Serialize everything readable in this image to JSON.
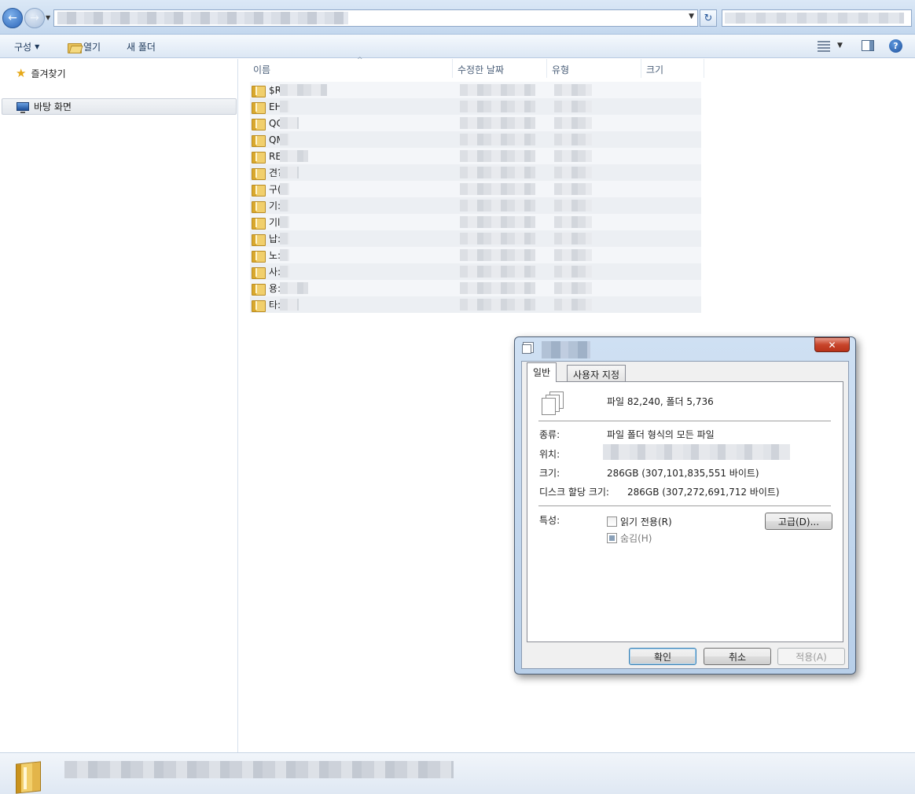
{
  "toolbar": {
    "organize_label": "구성",
    "open_label": "열기",
    "new_folder_label": "새 폴더"
  },
  "nav_pane": {
    "favorites_label": "즐겨찾기",
    "desktop_label": "바탕 화면"
  },
  "file_list": {
    "columns": {
      "name": "이름",
      "date_modified": "수정한 날짜",
      "type": "유형",
      "size": "크기"
    },
    "rows": [
      {
        "name": "$R"
      },
      {
        "name": "EH"
      },
      {
        "name": "QC"
      },
      {
        "name": "QM"
      },
      {
        "name": "REI"
      },
      {
        "name": "견?"
      },
      {
        "name": "구("
      },
      {
        "name": "기:"
      },
      {
        "name": "기l"
      },
      {
        "name": "납:"
      },
      {
        "name": "노:"
      },
      {
        "name": "사:"
      },
      {
        "name": "용:"
      },
      {
        "name": "타:"
      }
    ]
  },
  "dialog": {
    "close_glyph": "✕",
    "tabs": {
      "general": "일반",
      "custom": "사용자 지정"
    },
    "summary": "파일 82,240, 폴더 5,736",
    "type_label": "종류:",
    "type_value": "파일 폴더 형식의 모든 파일",
    "location_label": "위치:",
    "size_label": "크기:",
    "size_value": "286GB (307,101,835,551 바이트)",
    "disk_size_label": "디스크 할당 크기:",
    "disk_size_value": "286GB (307,272,691,712 바이트)",
    "attributes_label": "특성:",
    "readonly_label": "읽기 전용(R)",
    "hidden_label": "숨김(H)",
    "advanced_button": "고급(D)...",
    "ok_button": "확인",
    "cancel_button": "취소",
    "apply_button": "적용(A)"
  },
  "colors": {
    "accent": "#3c7fb1",
    "title_gradient_top": "#cfe0f3",
    "close_red": "#c8452b"
  },
  "icons": {
    "back": "back-arrow-icon",
    "forward": "forward-arrow-icon",
    "refresh": "refresh-icon",
    "favorites": "star-icon",
    "desktop": "desktop-icon",
    "folder": "folder-icon",
    "help": "help-icon"
  }
}
